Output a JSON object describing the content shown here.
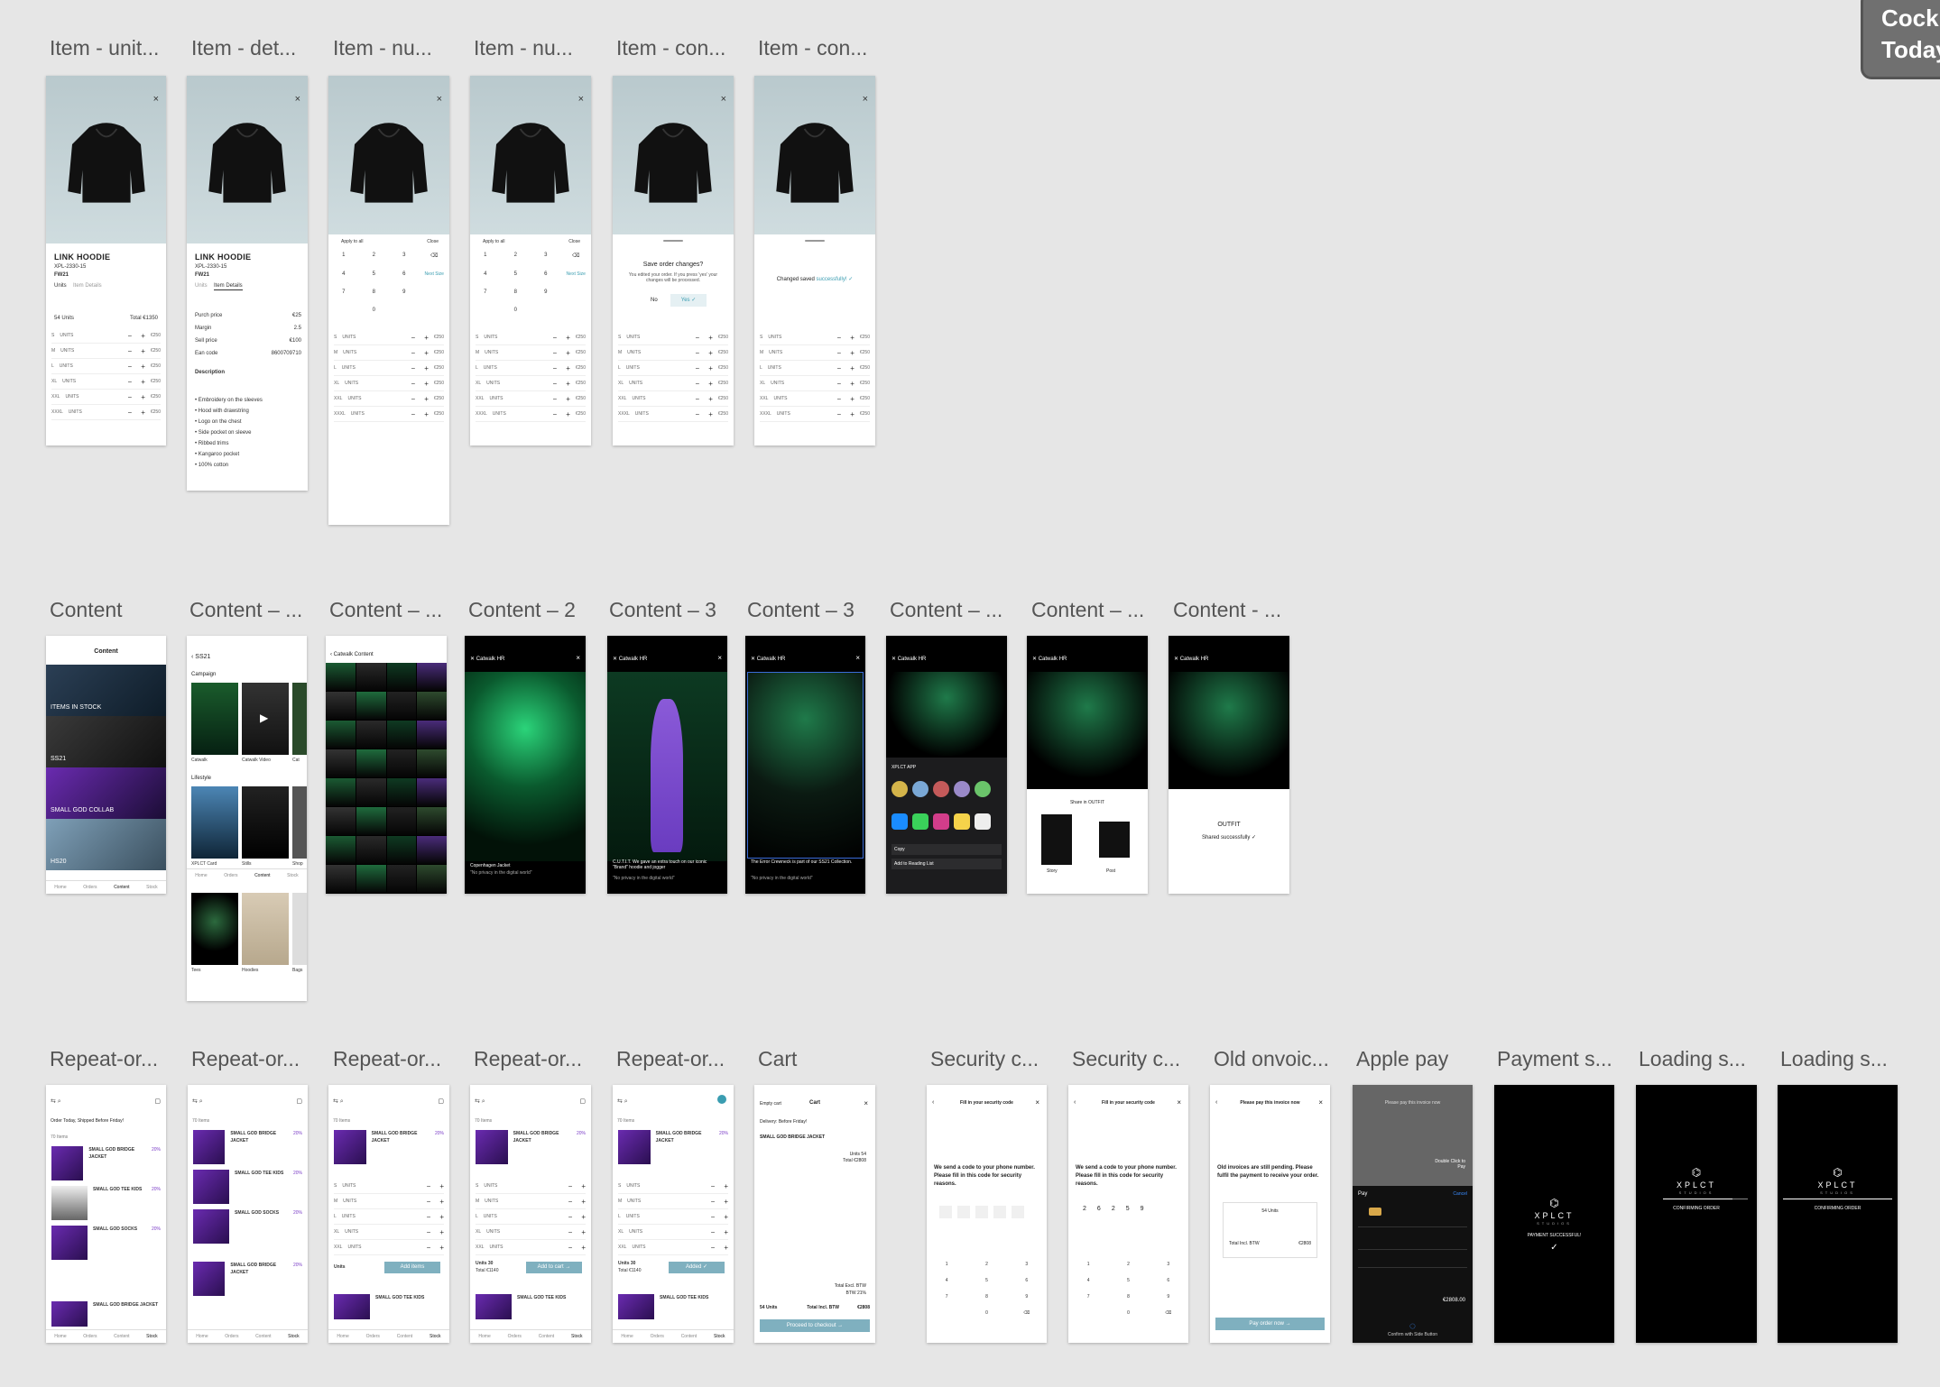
{
  "overlay": {
    "line1": "Cockpit",
    "line2": "Today"
  },
  "row1_labels": [
    "Item - unit...",
    "Item - det...",
    "Item - nu...",
    "Item - nu...",
    "Item - con...",
    "Item - con..."
  ],
  "row2_labels": [
    "Content",
    "Content – ...",
    "Content – ...",
    "Content – 2",
    "Content – 3",
    "Content – 3",
    "Content – ...",
    "Content – ...",
    "Content - ..."
  ],
  "row3_labels": [
    "Repeat-or...",
    "Repeat-or...",
    "Repeat-or...",
    "Repeat-or...",
    "Repeat-or...",
    "Cart",
    "Security c...",
    "Security c...",
    "Old onvoic...",
    "Apple pay",
    "Payment s...",
    "Loading s...",
    "Loading s..."
  ],
  "item": {
    "title": "LINK HOODIE",
    "sku": "XPL-2330-15",
    "season": "FW21",
    "tab_units": "Units",
    "tab_details": "Item Details",
    "units_summary": "54 Units",
    "total": "Total €1350",
    "sizes": [
      "S",
      "M",
      "L",
      "XL",
      "XXL",
      "XXXL"
    ],
    "units_word": "UNITS",
    "price": "€250",
    "details": [
      "Purch price",
      "Margin",
      "Sell price",
      "Ean code"
    ],
    "detail_values": [
      "€25",
      "2.5",
      "€100",
      "8600709710"
    ],
    "description_title": "Description",
    "bullets": [
      "Embroidery on the sleeves",
      "Hood with drawstring",
      "Logo on the chest",
      "Side pocket on sleeve",
      "Ribbed trims",
      "Kangaroo pocket",
      "100% cotton"
    ],
    "apply_all": "Apply to all",
    "close": "Close",
    "keys": [
      "1",
      "2",
      "3",
      "⌫",
      "4",
      "5",
      "6",
      "Next Size",
      "7",
      "8",
      "9",
      "",
      "",
      "0",
      "",
      ""
    ],
    "save_title": "Save order changes?",
    "save_body": "You edited your order. If you press 'yes' your changes will be processed.",
    "no": "No",
    "yes": "Yes",
    "saved_prefix": "Changed saved",
    "saved_suffix": "successfully!"
  },
  "content": {
    "title": "Content",
    "tiles": [
      "ITEMS IN STOCK",
      "SS21",
      "SMALL GOD COLLAB",
      "HS20"
    ],
    "ss21_back": "SS21",
    "campaign": "Campaign",
    "campaign_items": [
      "Catwalk",
      "Catwalk Video",
      "Cat"
    ],
    "lifestyle": "Lifestyle",
    "lifestyle_items": [
      "XPLCT Card",
      "Stills",
      "Shop"
    ],
    "more_items": [
      "Tees",
      "Hoodies",
      "Bags"
    ],
    "catwalk_title": "Catwalk Content",
    "viewer_title": "Catwalk HR",
    "caption1": "Copenhagen Jacket",
    "caption2": "C.U.T.I.T. We gave an extra touch on our iconic \"Brand\" hoodie and jogger",
    "caption3": "The Error Crewneck is part of our SS21 Collection.",
    "tagline": "\"No privacy in the digital world\"",
    "share_app": "XPLCT APP",
    "copy": "Copy",
    "reading_list": "Add to Reading List",
    "share_ig": "Share in OUTFIT",
    "story": "Story",
    "post": "Post",
    "outfit": "OUTFIT",
    "shared": "Shared successfully"
  },
  "tabs": [
    "Home",
    "Orders",
    "Content",
    "Stock"
  ],
  "repeat": {
    "banner": "Order Today, Shipped Before Friday!",
    "count": "70 Items",
    "products": [
      "SMALL GOD BRIDGE JACKET",
      "SMALL GOD TEE KIDS",
      "SMALL GOD SOCKS",
      "SMALL GOD BRIDGE JACKET"
    ],
    "price": "€24",
    "pct": "20%",
    "units_label": "Units",
    "units_total": "Units 30",
    "total": "Total €1140",
    "add_items": "Add items",
    "add_to_cart": "Add to cart →",
    "added": "Added ✓"
  },
  "cart": {
    "empty": "Empty cart",
    "title": "Cart",
    "delivery": "Delivery: Before Friday!",
    "product": "SMALL GOD BRIDGE JACKET",
    "units": "Units 54",
    "total_incl": "Total €2808",
    "excl": "Total Excl. BTW",
    "btw": "BTW 21%",
    "grand_units": "54 Units",
    "grand_total": "Total Incl. BTW",
    "grand_value": "€2808",
    "checkout": "Proceed to checkout →"
  },
  "security": {
    "title": "Fill in your security code",
    "body": "We send a code to your phone number. Please fill in this code for security reasons.",
    "entered": [
      "2",
      "6",
      "2",
      "5",
      "9"
    ]
  },
  "invoice": {
    "title": "Please pay this invoice now",
    "body": "Old invoices are still pending. Please fulfil the payment to receive your order.",
    "units": "54 Units",
    "total": "Total Incl. BTW",
    "value": "€2808",
    "pay": "Pay order now →"
  },
  "applepay": {
    "pay_label": "Pay",
    "cancel": "Cancel",
    "double_click": "Double Click to Pay",
    "confirm": "Confirm with Side Button",
    "amount": "€2808.00"
  },
  "brand": {
    "name": "XPLCT",
    "sub": "STUDIOS"
  },
  "payment_success": "PAYMENT SUCCESSFUL!",
  "confirming": "CONFIRMING ORDER",
  "colors": {
    "teal": "#7fb0bf",
    "purple": "#7a3cc7",
    "green": "#1fc46a",
    "bg": "#e6e6e6"
  }
}
